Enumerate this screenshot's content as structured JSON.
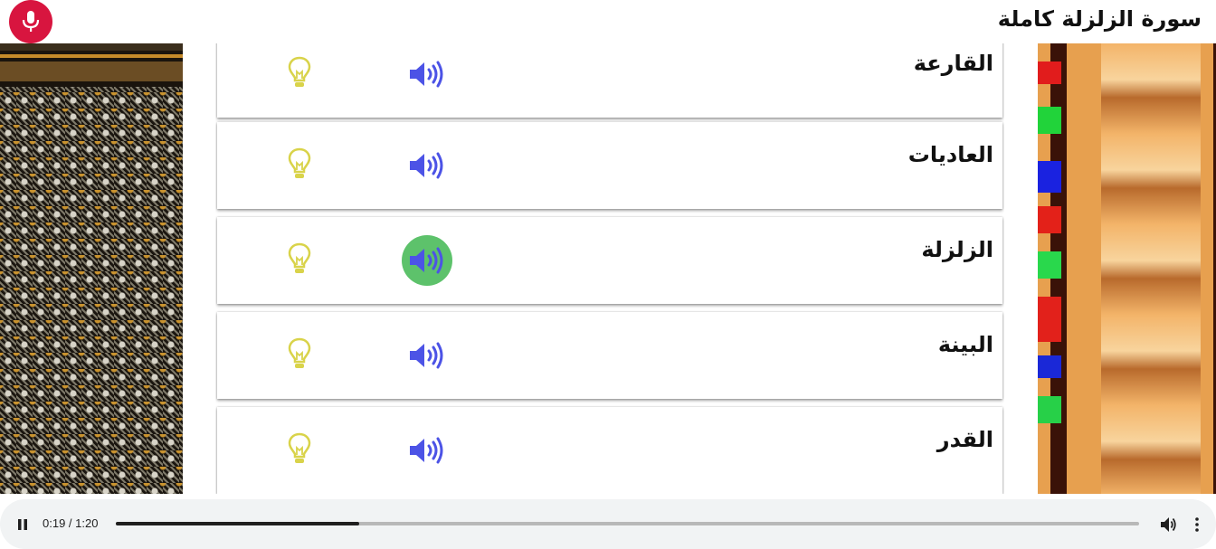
{
  "header": {
    "title": "سورة الزلزلة كاملة",
    "mic_icon": "microphone-icon",
    "mic_color": "#d8153f"
  },
  "surahs": [
    {
      "name": "القارعة",
      "audio_icon": "speaker-icon",
      "hint_icon": "lightbulb-icon",
      "active": false
    },
    {
      "name": "العاديات",
      "audio_icon": "speaker-icon",
      "hint_icon": "lightbulb-icon",
      "active": false
    },
    {
      "name": "الزلزلة",
      "audio_icon": "speaker-icon",
      "hint_icon": "lightbulb-icon",
      "active": true
    },
    {
      "name": "البينة",
      "audio_icon": "speaker-icon",
      "hint_icon": "lightbulb-icon",
      "active": false
    },
    {
      "name": "القدر",
      "audio_icon": "speaker-icon",
      "hint_icon": "lightbulb-icon",
      "active": false
    }
  ],
  "colors": {
    "speaker": "#4c53e6",
    "active_bg": "#5dc26b",
    "lightbulb": "#d9d34a"
  },
  "player": {
    "state": "playing",
    "time": "0:19 / 1:20",
    "progress": 0.2375,
    "pause_icon": "pause-icon",
    "volume_icon": "volume-icon",
    "more_icon": "more-vert-icon"
  }
}
